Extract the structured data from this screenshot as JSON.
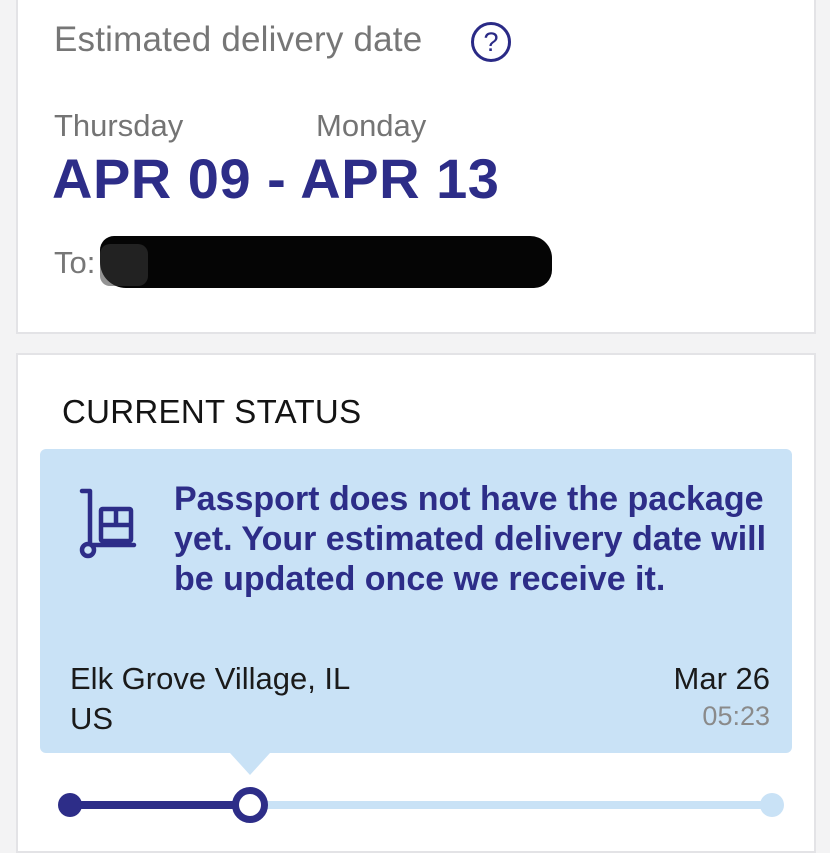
{
  "delivery": {
    "label": "Estimated delivery date",
    "help_icon": "question-circle-icon",
    "start_day": "Thursday",
    "end_day": "Monday",
    "date_range": "APR 09 - APR 13",
    "to_label": "To:"
  },
  "status": {
    "title": "CURRENT STATUS",
    "icon": "hand-truck-icon",
    "message": "Passport does not have the package yet. Your estimated delivery date will be updated once we receive it.",
    "city": "Elk Grove Village, IL",
    "country": "US",
    "date": "Mar 26",
    "time": "05:23"
  },
  "progress": {
    "current_step": 2,
    "total_steps": 3
  },
  "colors": {
    "brand": "#2d2d88",
    "status_background": "#c9e2f6",
    "page_background": "#f3f3f4"
  }
}
